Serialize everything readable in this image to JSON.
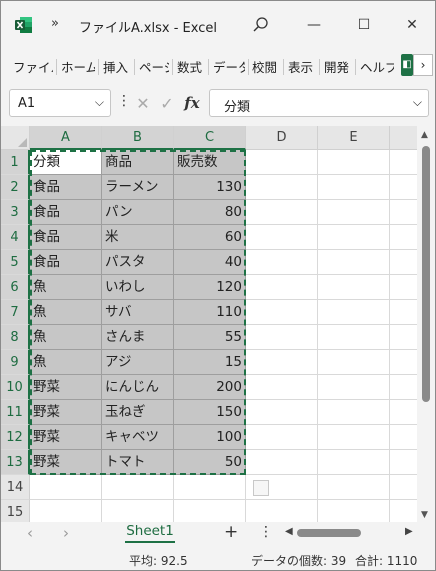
{
  "window": {
    "title": "ファイルA.xlsx  -  Excel",
    "qat_label": "»",
    "minimize": "—",
    "maximize": "☐",
    "close": "✕"
  },
  "ribbon": {
    "tabs": [
      "ファイル",
      "ホーム",
      "挿入",
      "ページ",
      "数式",
      "データ",
      "校閲",
      "表示",
      "開発",
      "ヘルプ"
    ],
    "more": "›"
  },
  "formula_bar": {
    "name_box": "A1",
    "content": "分類"
  },
  "columns": [
    "A",
    "B",
    "C",
    "D",
    "E"
  ],
  "rows": [
    {
      "num": "1",
      "cells": [
        "分類",
        "商品",
        "販売数"
      ]
    },
    {
      "num": "2",
      "cells": [
        "食品",
        "ラーメン",
        "130"
      ]
    },
    {
      "num": "3",
      "cells": [
        "食品",
        "パン",
        "80"
      ]
    },
    {
      "num": "4",
      "cells": [
        "食品",
        "米",
        "60"
      ]
    },
    {
      "num": "5",
      "cells": [
        "食品",
        "パスタ",
        "40"
      ]
    },
    {
      "num": "6",
      "cells": [
        "魚",
        "いわし",
        "120"
      ]
    },
    {
      "num": "7",
      "cells": [
        "魚",
        "サバ",
        "110"
      ]
    },
    {
      "num": "8",
      "cells": [
        "魚",
        "さんま",
        "55"
      ]
    },
    {
      "num": "9",
      "cells": [
        "魚",
        "アジ",
        "15"
      ]
    },
    {
      "num": "10",
      "cells": [
        "野菜",
        "にんじん",
        "200"
      ]
    },
    {
      "num": "11",
      "cells": [
        "野菜",
        "玉ねぎ",
        "150"
      ]
    },
    {
      "num": "12",
      "cells": [
        "野菜",
        "キャベツ",
        "100"
      ]
    },
    {
      "num": "13",
      "cells": [
        "野菜",
        "トマト",
        "50"
      ]
    },
    {
      "num": "14",
      "cells": [
        "",
        "",
        ""
      ]
    },
    {
      "num": "15",
      "cells": [
        "",
        "",
        ""
      ]
    }
  ],
  "sheet_tabs": {
    "active": "Sheet1",
    "add": "+"
  },
  "status": {
    "average": "平均: 92.5",
    "count": "データの個数: 39",
    "sum": "合計: 1110"
  },
  "colors": {
    "accent": "#1e7145",
    "selection": "#c6c6c6"
  }
}
